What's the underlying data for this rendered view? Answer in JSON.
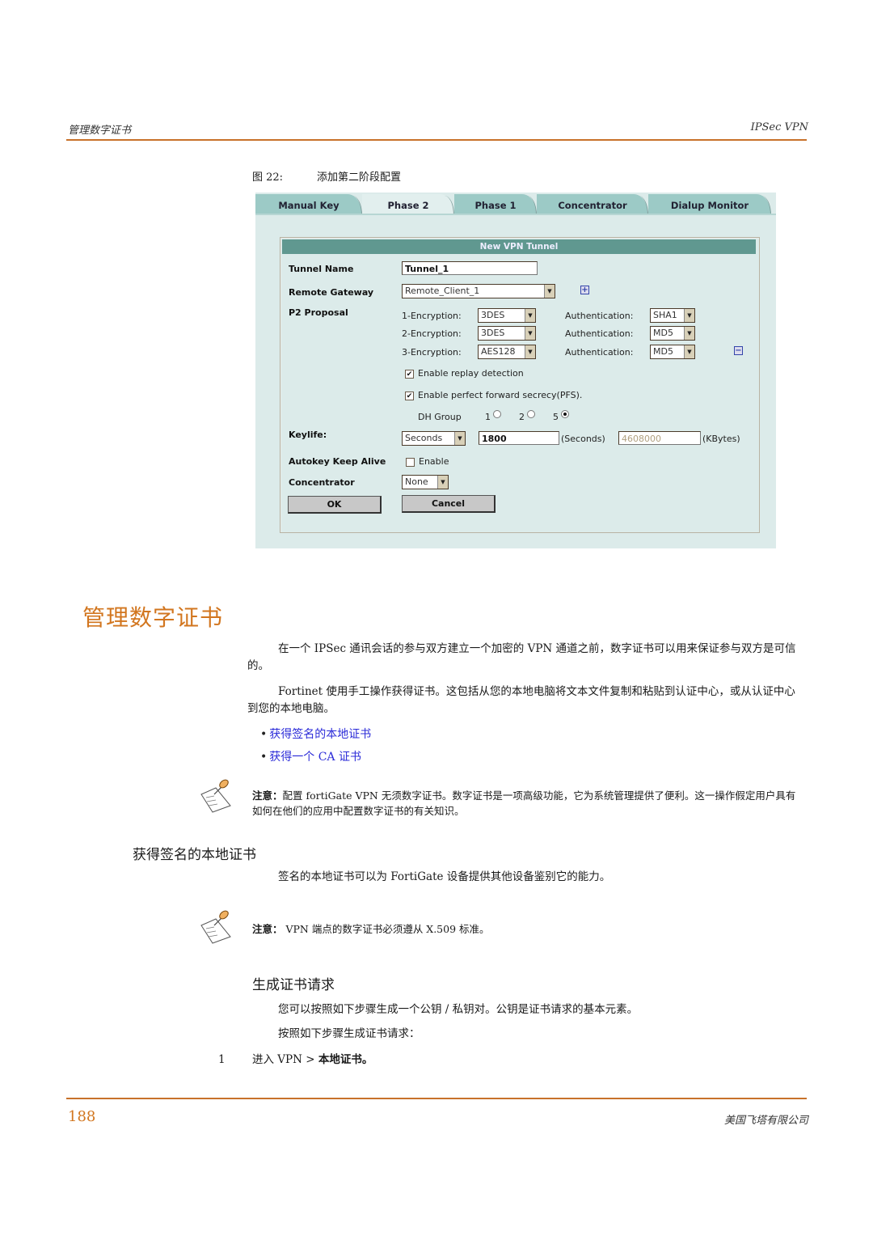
{
  "header": {
    "left": "管理数字证书",
    "right": "IPSec VPN"
  },
  "figure": {
    "number": "图 22:",
    "caption": "添加第二阶段配置",
    "tabs": [
      "Manual Key",
      "Phase 2",
      "Phase 1",
      "Concentrator",
      "Dialup Monitor"
    ],
    "active_tab": "Phase 2",
    "panel_title": "New VPN Tunnel",
    "form": {
      "tunnel_name_label": "Tunnel Name",
      "tunnel_name_value": "Tunnel_1",
      "remote_gateway_label": "Remote Gateway",
      "remote_gateway_value": "Remote_Client_1",
      "p2_proposal_label": "P2 Proposal",
      "proposals": [
        {
          "enc_label": "1-Encryption:",
          "enc": "3DES",
          "auth_label": "Authentication:",
          "auth": "SHA1"
        },
        {
          "enc_label": "2-Encryption:",
          "enc": "3DES",
          "auth_label": "Authentication:",
          "auth": "MD5"
        },
        {
          "enc_label": "3-Encryption:",
          "enc": "AES128",
          "auth_label": "Authentication:",
          "auth": "MD5"
        }
      ],
      "replay_label": "Enable replay detection",
      "replay_checked": true,
      "pfs_label": "Enable perfect forward secrecy(PFS).",
      "pfs_checked": true,
      "dh_group_label": "DH Group",
      "dh_options": [
        "1",
        "2",
        "5"
      ],
      "dh_selected": "5",
      "keylife_label": "Keylife:",
      "keylife_unit": "Seconds",
      "keylife_seconds": "1800",
      "seconds_suffix": "(Seconds)",
      "keylife_kbytes": "4608000",
      "kbytes_suffix": "(KBytes)",
      "autokey_label": "Autokey Keep Alive",
      "autokey_enable_label": "Enable",
      "autokey_checked": false,
      "concentrator_label": "Concentrator",
      "concentrator_value": "None",
      "ok_label": "OK",
      "cancel_label": "Cancel",
      "check_glyph": "✔",
      "arrow_glyph": "▼",
      "plus_glyph": "+",
      "minus_glyph": "−"
    }
  },
  "section": {
    "title": "管理数字证书",
    "para1": "在一个 IPSec 通讯会话的参与双方建立一个加密的 VPN 通道之前，数字证书可以用来保证参与双方是可信的。",
    "para2": "Fortinet 使用手工操作获得证书。这包括从您的本地电脑将文本文件复制和粘贴到认证中心，或从认证中心到您的本地电脑。",
    "links": [
      "获得签名的本地证书",
      "获得一个 CA 证书"
    ],
    "bullet": "•",
    "note1_label": "注意：",
    "note1_text": "配置 fortiGate VPN 无须数字证书。数字证书是一项高级功能，它为系统管理提供了便利。这一操作假定用户具有如何在他们的应用中配置数字证书的有关知识。"
  },
  "subsection": {
    "title": "获得签名的本地证书",
    "para": "签名的本地证书可以为 FortiGate 设备提供其他设备鉴别它的能力。",
    "note_label": "注意：",
    "note_text": " VPN 端点的数字证书必须遵从 X.509 标准。"
  },
  "subsubsection": {
    "title": "生成证书请求",
    "para1": "您可以按照如下步骤生成一个公钥 / 私钥对。公钥是证书请求的基本元素。",
    "para2": "按照如下步骤生成证书请求：",
    "step_num": "1",
    "step_prefix": "进入 VPN > ",
    "step_bold": "本地证书。"
  },
  "footer": {
    "page": "188",
    "company": "美国飞塔有限公司"
  },
  "colors": {
    "accent": "#d2761f",
    "rule": "#c8722a",
    "link": "#2b2bd8",
    "panel_bg": "#dcebea",
    "panel_title_bg": "#609890",
    "tab_bg": "#9ccac6"
  }
}
